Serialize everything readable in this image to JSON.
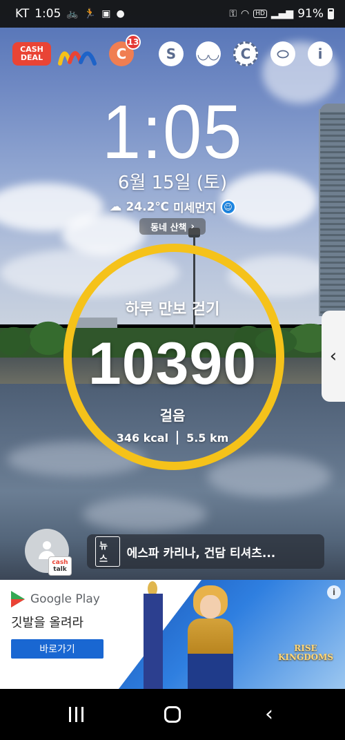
{
  "status_bar": {
    "carrier": "KT",
    "time": "1:05",
    "battery": "91%",
    "icons": [
      "bike-icon",
      "runner-icon",
      "image-icon",
      "dot-icon",
      "lock-icon",
      "wifi-icon",
      "hd-icon",
      "signal-icon",
      "battery-icon"
    ]
  },
  "shortcuts": {
    "cashdeal_line1": "CASH",
    "cashdeal_line2": "DEAL",
    "badge_letter": "C",
    "badge_count": "13",
    "icons": [
      "cash-deal-logo",
      "m-logo",
      "c-app-icon",
      "s-icon",
      "mask-icon",
      "coin-icon",
      "pill-icon",
      "info-heart-icon"
    ]
  },
  "clock": {
    "time": "1:05",
    "date": "6월 15일 (토)",
    "temperature": "24.2℃",
    "air_quality": "미세먼지",
    "walk_button": "동네 산책"
  },
  "pedometer": {
    "title": "하루 만보 걷기",
    "steps": "10390",
    "unit": "걸음",
    "calories": "346 kcal",
    "distance": "5.5 km",
    "ring_color": "#f5c21a"
  },
  "cashtalk": {
    "label_line1": "cash",
    "label_line2": "talk"
  },
  "news": {
    "tag": "뉴스",
    "headline": "에스파 카리나, 건담 티셔츠..."
  },
  "ad": {
    "brand": "Google Play",
    "tagline": "깃발을 올려라",
    "button": "바로가기",
    "game_line1": "RISE",
    "game_line2": "KINGDOMS",
    "info_glyph": "i"
  },
  "nav": {
    "back_glyph": "‹"
  }
}
